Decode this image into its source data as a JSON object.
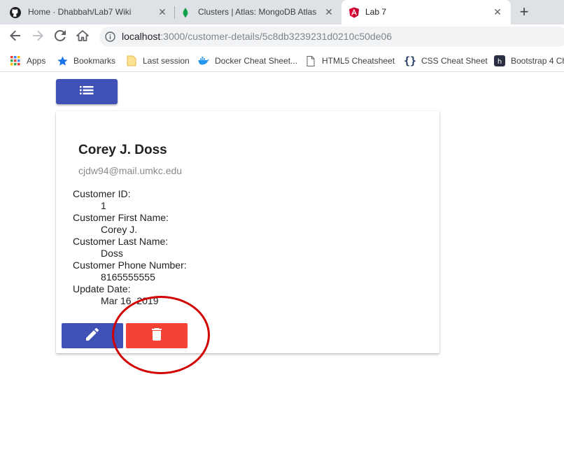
{
  "browser": {
    "tabs": [
      {
        "title": "Home · Dhabbah/Lab7 Wiki",
        "icon": "github-icon"
      },
      {
        "title": "Clusters | Atlas: MongoDB Atlas",
        "icon": "mongodb-leaf-icon"
      },
      {
        "title": "Lab 7",
        "icon": "angular-icon",
        "active": true
      }
    ],
    "new_tab_symbol": "+",
    "close_symbol": "✕",
    "url_host": "localhost",
    "url_path": ":3000/customer-details/5c8db3239231d0210c50de06"
  },
  "bookmarks": [
    {
      "label": "Apps",
      "icon": "apps-grid-icon"
    },
    {
      "label": "Bookmarks",
      "icon": "star-icon"
    },
    {
      "label": "Last session",
      "icon": "folder-icon"
    },
    {
      "label": "Docker Cheat Sheet...",
      "icon": "docker-icon"
    },
    {
      "label": "HTML5 Cheatsheet",
      "icon": "page-icon"
    },
    {
      "label": "CSS Cheat Sheet",
      "icon": "braces-icon"
    },
    {
      "label": "Bootstrap 4 Ch",
      "icon": "hackerrank-icon"
    }
  ],
  "customer": {
    "name": "Corey J. Doss",
    "email": "cjdw94@mail.umkc.edu",
    "fields": [
      {
        "label": "Customer ID:",
        "value": "1"
      },
      {
        "label": "Customer First Name:",
        "value": "Corey J."
      },
      {
        "label": "Customer Last Name:",
        "value": "Doss"
      },
      {
        "label": "Customer Phone Number:",
        "value": "8165555555"
      },
      {
        "label": "Update Date:",
        "value": "Mar 16, 2019"
      }
    ]
  },
  "colors": {
    "primary": "#3f51b5",
    "warn": "#f44336",
    "annotation": "#d20000"
  }
}
